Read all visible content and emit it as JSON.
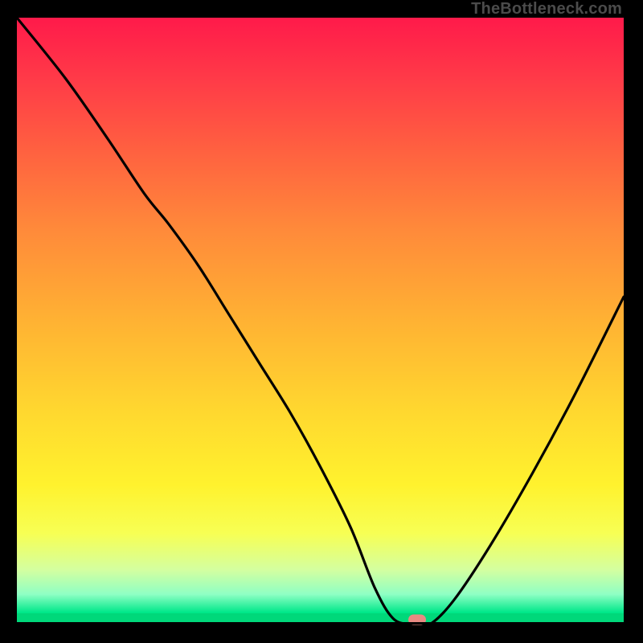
{
  "watermark_text": "TheBottleneck.com",
  "chart_data": {
    "type": "line",
    "title": "",
    "xlabel": "",
    "ylabel": "",
    "xlim": [
      0,
      100
    ],
    "ylim": [
      0,
      100
    ],
    "grid": false,
    "legend": false,
    "series": [
      {
        "name": "bottleneck-curve",
        "x": [
          0,
          8,
          15,
          21,
          25,
          30,
          35,
          40,
          45,
          50,
          55,
          59,
          62,
          65,
          68,
          72,
          78,
          85,
          92,
          100
        ],
        "values": [
          100,
          90,
          80,
          71,
          66,
          59,
          51,
          43,
          35,
          26,
          16,
          6,
          1,
          0,
          0,
          4,
          13,
          25,
          38,
          54
        ]
      }
    ],
    "marker": {
      "x": 66,
      "y": 0,
      "name": "optimal-point"
    },
    "background_gradient": {
      "top": "#ff1a4a",
      "mid": "#ffd82f",
      "bottom": "#00d87a"
    }
  }
}
